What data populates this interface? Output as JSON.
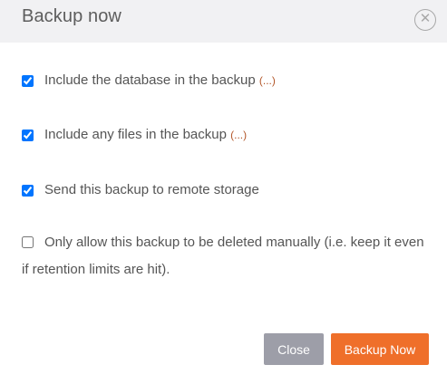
{
  "dialog": {
    "title": "Backup now",
    "close_icon_glyph": "✕"
  },
  "options": [
    {
      "label": "Include the database in the backup",
      "more": "(...)",
      "checked": true
    },
    {
      "label": "Include any files in the backup",
      "more": "(...)",
      "checked": true
    },
    {
      "label": "Send this backup to remote storage",
      "checked": true
    },
    {
      "label": "Only allow this backup to be deleted manually (i.e. keep it even if retention limits are hit).",
      "checked": false
    }
  ],
  "buttons": {
    "close_label": "Close",
    "backup_label": "Backup Now"
  },
  "colors": {
    "header_bg": "#f1f1f3",
    "primary_button": "#ef6f2a",
    "secondary_button": "#9d9ea8",
    "link_accent": "#b3572a"
  }
}
